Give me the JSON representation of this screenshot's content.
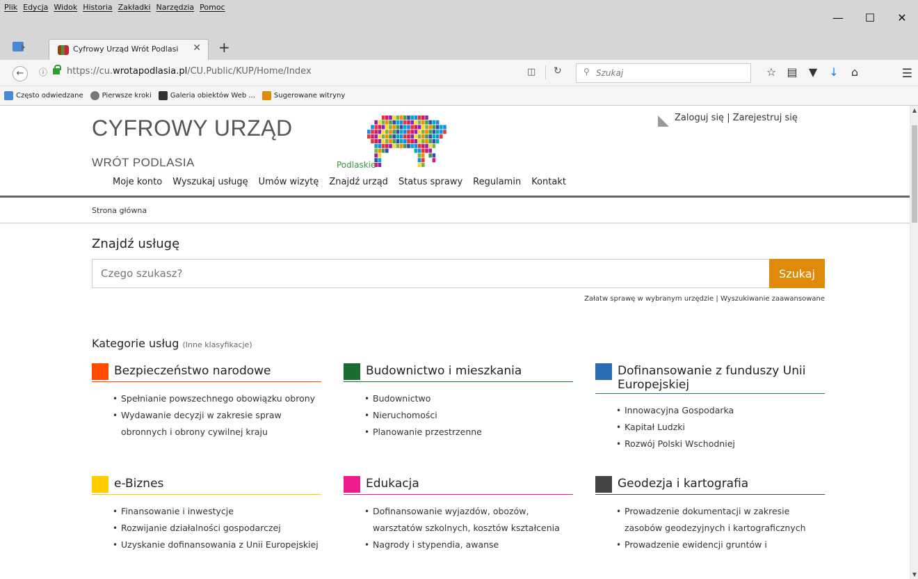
{
  "menubar": {
    "items": [
      "Plik",
      "Edycja",
      "Widok",
      "Historia",
      "Zakładki",
      "Narzędzia",
      "Pomoc"
    ]
  },
  "window": {
    "minimize": "—",
    "maximize": "☐",
    "close": "✕"
  },
  "tab": {
    "title": "Cyfrowy Urząd Wrót Podlasi",
    "close": "✕",
    "new": "+"
  },
  "address": {
    "url_prefix": "https://cu.",
    "url_domain": "wrotapodlasia.pl",
    "url_path": "/CU.Public/KUP/Home/Index"
  },
  "search": {
    "placeholder": "Szukaj"
  },
  "bookmarks": [
    {
      "label": "Często odwiedzane",
      "color": "#4a87d6"
    },
    {
      "label": "Pierwsze kroki",
      "color": "#777777"
    },
    {
      "label": "Galeria obiektów Web ...",
      "color": "#333333"
    },
    {
      "label": "Sugerowane witryny",
      "color": "#e08a0b"
    }
  ],
  "site": {
    "title": "CYFROWY URZĄD",
    "subtitle": "WRÓT PODLASIA",
    "logo_caption": "Podlaskie",
    "login": "Zaloguj się",
    "register": "Zarejestruj się",
    "nav": [
      "Moje konto",
      "Wyszukaj usługę",
      "Umów wizytę",
      "Znajdź urząd",
      "Status sprawy",
      "Regulamin",
      "Kontakt"
    ],
    "breadcrumb": "Strona główna",
    "find_title": "Znajdź usługę",
    "find_placeholder": "Czego szukasz?",
    "find_button": "Szukaj",
    "link_office": "Załatw sprawę w wybranym urzędzie",
    "link_advanced": "Wyszukiwanie zaawansowane",
    "categories_title": "Kategorie usług",
    "categories_other": "(Inne klasyfikacje)"
  },
  "categories": [
    {
      "name": "Bezpieczeństwo narodowe",
      "color": "#ff4c00",
      "items": [
        "Spełnianie powszechnego obowiązku obrony",
        "Wydawanie decyzji w zakresie spraw obronnych i obrony cywilnej kraju"
      ]
    },
    {
      "name": "Budownictwo i mieszkania",
      "color": "#1a6d2e",
      "items": [
        "Budownictwo",
        "Nieruchomości",
        "Planowanie przestrzenne"
      ]
    },
    {
      "name": "Dofinansowanie z funduszy Unii Europejskiej",
      "color": "#2a6db5",
      "items": [
        "Innowacyjna Gospodarka",
        "Kapitał Ludzki",
        "Rozwój Polski Wschodniej"
      ]
    },
    {
      "name": "e-Biznes",
      "color": "#ffcc00",
      "items": [
        "Finansowanie i inwestycje",
        "Rozwijanie działalności gospodarczej",
        "Uzyskanie dofinansowania z Unii Europejskiej"
      ]
    },
    {
      "name": "Edukacja",
      "color": "#ee1c8c",
      "items": [
        "Dofinansowanie wyjazdów, obozów, warsztatów szkolnych, kosztów kształcenia",
        "Nagrody i stypendia, awanse"
      ]
    },
    {
      "name": "Geodezja i kartografia",
      "color": "#444444",
      "items": [
        "Prowadzenie dokumentacji w zakresie zasobów geodezyjnych i kartograficznych",
        "Prowadzenie ewidencji gruntów i"
      ]
    }
  ]
}
